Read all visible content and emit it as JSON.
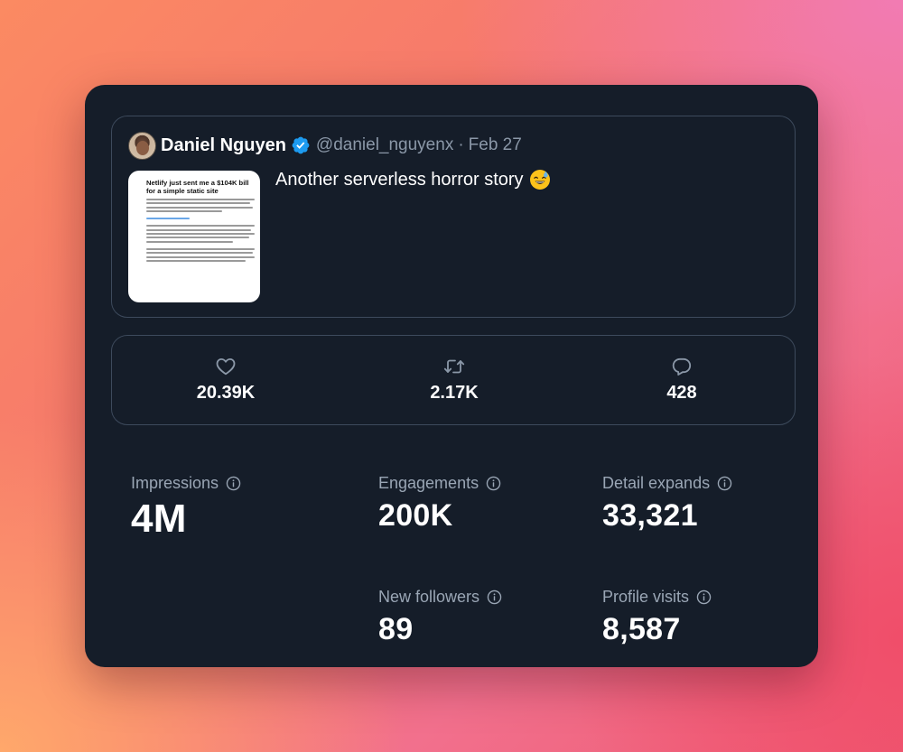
{
  "tweet": {
    "author_name": "Daniel Nguyen",
    "handle": "@daniel_nguyenx",
    "separator": "·",
    "date": "Feb 27",
    "text": "Another serverless horror story",
    "emoji": "grinning-sweat-emoji",
    "media": {
      "title": "Netlify just sent me a $104K bill for a simple static site"
    }
  },
  "engagement": {
    "likes": {
      "icon": "heart-icon",
      "count": "20.39K"
    },
    "retweets": {
      "icon": "retweet-icon",
      "count": "2.17K"
    },
    "replies": {
      "icon": "reply-icon",
      "count": "428"
    }
  },
  "stats": {
    "impressions": {
      "label": "Impressions",
      "value": "4M"
    },
    "engagements": {
      "label": "Engagements",
      "value": "200K"
    },
    "detail_expands": {
      "label": "Detail expands",
      "value": "33,321"
    },
    "new_followers": {
      "label": "New followers",
      "value": "89"
    },
    "profile_visits": {
      "label": "Profile visits",
      "value": "8,587"
    }
  },
  "colors": {
    "card_bg": "#151d29",
    "border": "#3d4a5c",
    "verified": "#1d9bf0",
    "muted_text": "#8b98a8"
  }
}
